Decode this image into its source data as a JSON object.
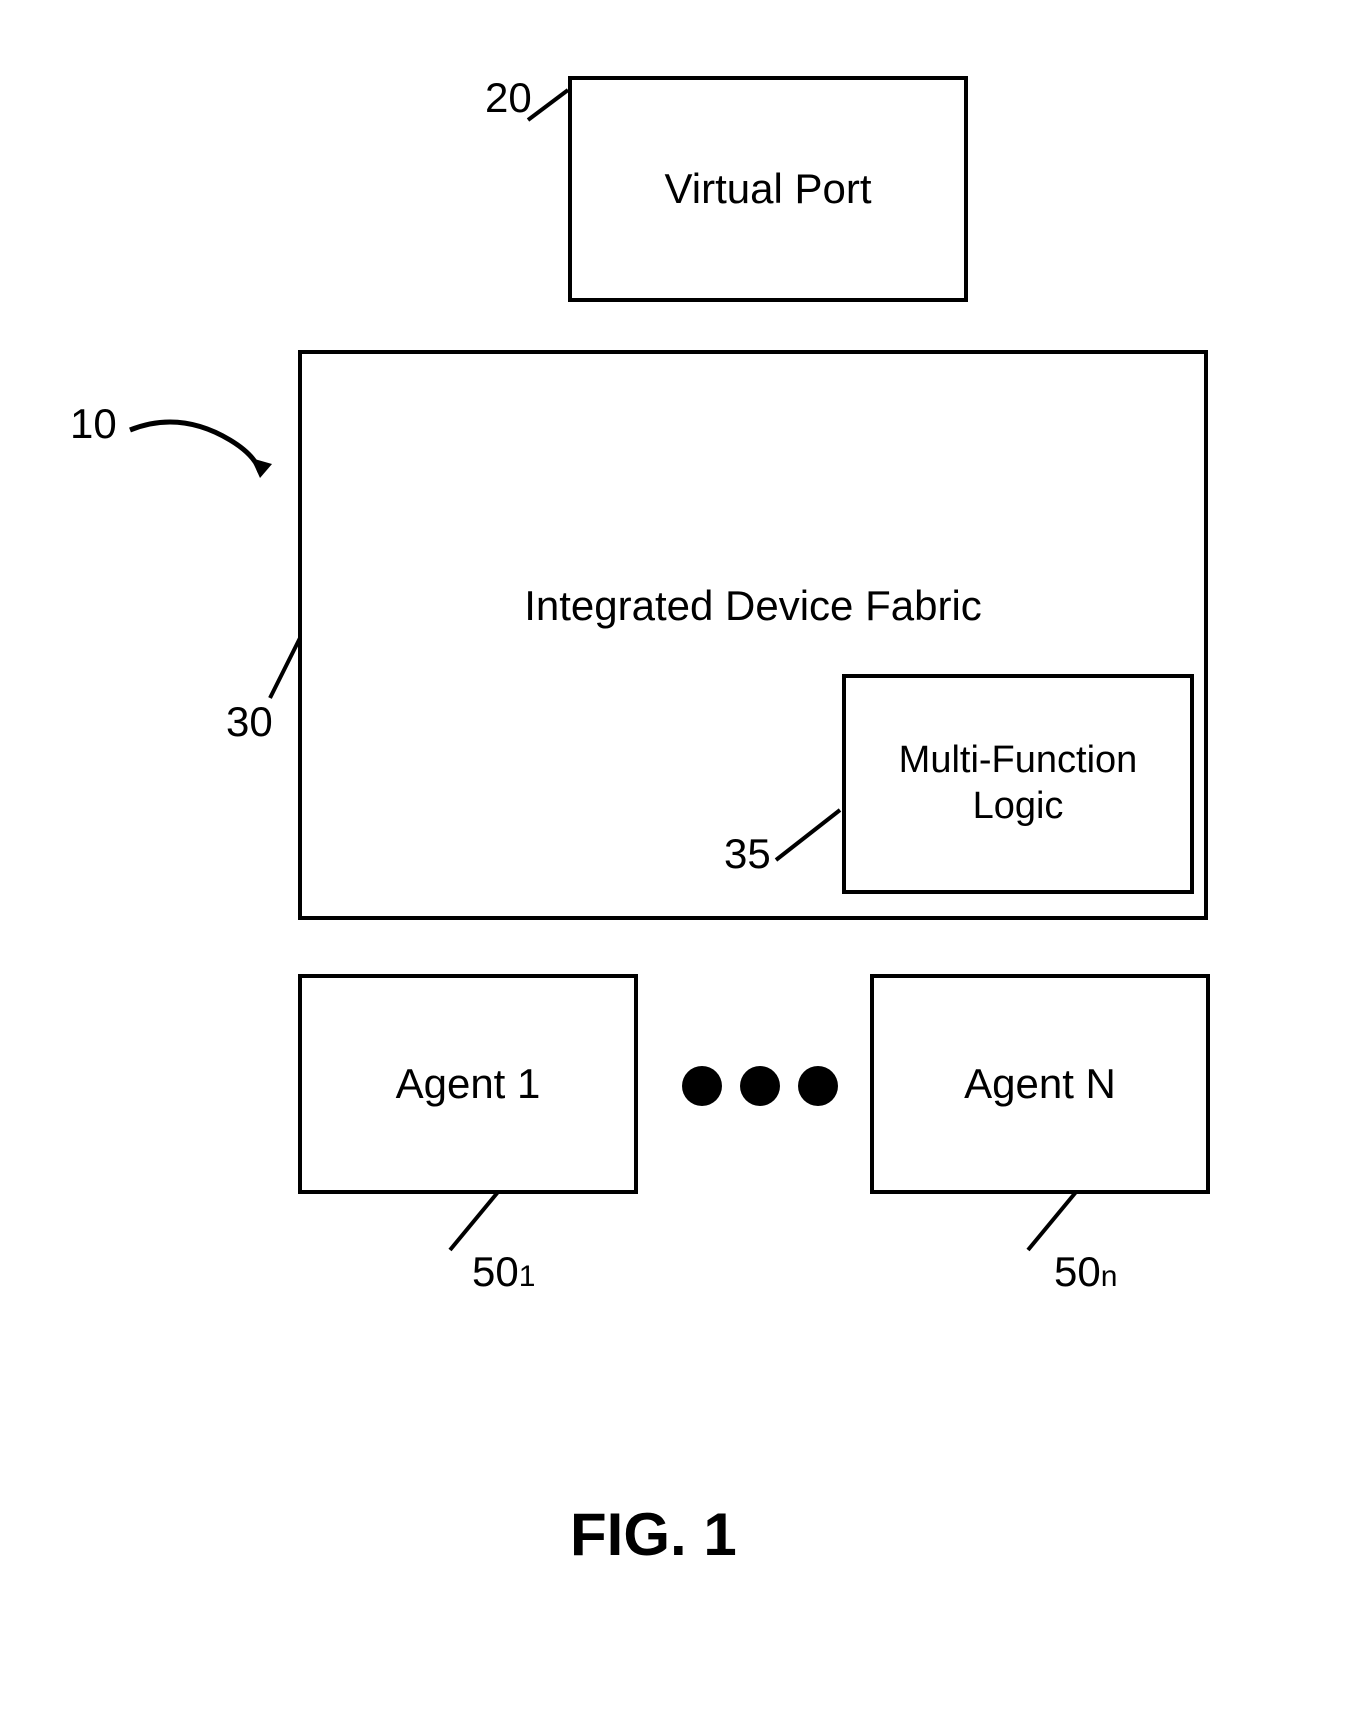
{
  "figure_label": "FIG. 1",
  "ref_10": "10",
  "ref_20": "20",
  "ref_30": "30",
  "ref_35": "35",
  "ref_50_1_main": "50",
  "ref_50_1_sub": "1",
  "ref_50_n_main": "50",
  "ref_50_n_sub": "n",
  "virtual_port": "Virtual Port",
  "idf": "Integrated Device Fabric",
  "mfl_line1": "Multi-Function",
  "mfl_line2": "Logic",
  "agent1": "Agent 1",
  "agentN": "Agent N"
}
